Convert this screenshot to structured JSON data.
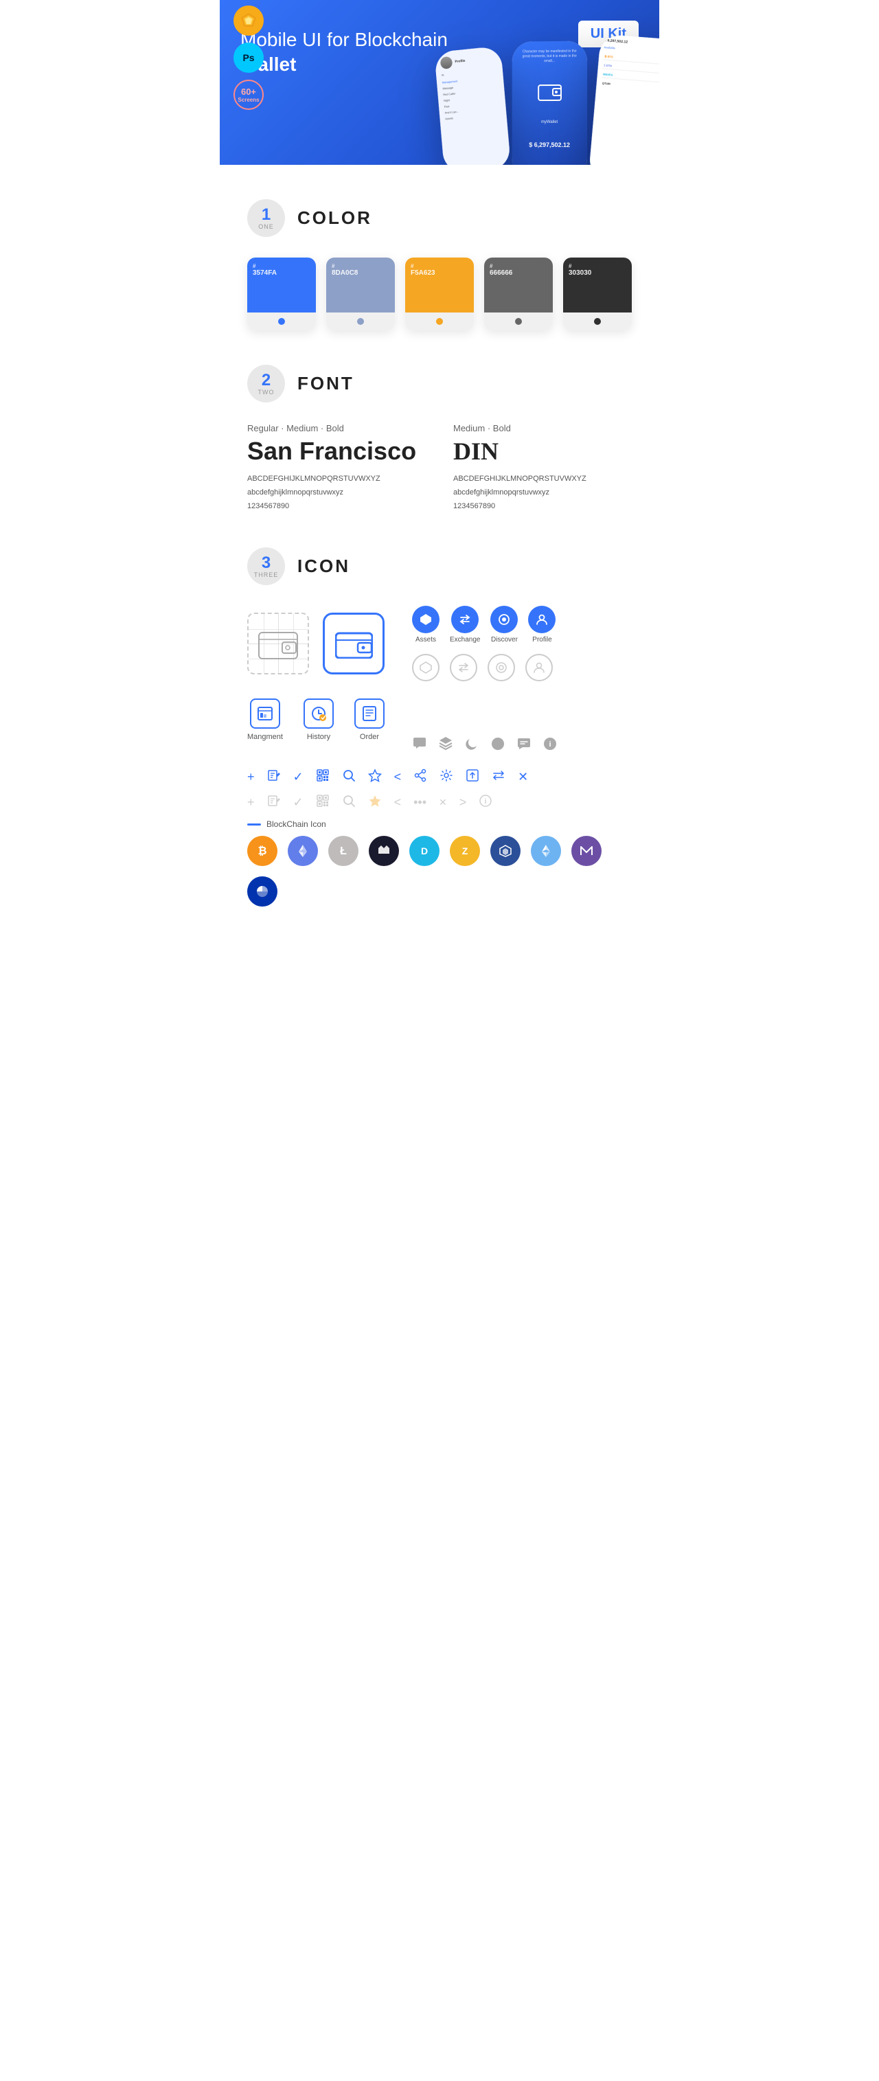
{
  "hero": {
    "title_regular": "Mobile UI for Blockchain ",
    "title_bold": "Wallet",
    "badge": "UI Kit",
    "sketch_label": "Sketch",
    "ps_label": "Ps",
    "screens_count": "60+",
    "screens_label": "Screens"
  },
  "sections": {
    "color": {
      "number": "1",
      "sub": "ONE",
      "title": "COLOR",
      "swatches": [
        {
          "hex": "#3574FA",
          "label": "3574FA",
          "dot_color": "#fff"
        },
        {
          "hex": "#8DA0C8",
          "label": "8DA0C8",
          "dot_color": "#fff"
        },
        {
          "hex": "#F5A623",
          "label": "F5A623",
          "dot_color": "#fff"
        },
        {
          "hex": "#666666",
          "label": "666666",
          "dot_color": "#fff"
        },
        {
          "hex": "#303030",
          "label": "303030",
          "dot_color": "#fff"
        }
      ]
    },
    "font": {
      "number": "2",
      "sub": "TWO",
      "title": "FONT",
      "font1": {
        "meta": "Regular · Medium · Bold",
        "name": "San Francisco",
        "uppercase": "ABCDEFGHIJKLMNOPQRSTUVWXYZ",
        "lowercase": "abcdefghijklmnopqrstuvwxyz",
        "numbers": "1234567890"
      },
      "font2": {
        "meta": "Medium · Bold",
        "name": "DIN",
        "uppercase": "ABCDEFGHIJKLMNOPQRSTUVWXYZ",
        "lowercase": "abcdefghijklmnopqrstuvwxyz",
        "numbers": "1234567890"
      }
    },
    "icon": {
      "number": "3",
      "sub": "THREE",
      "title": "ICON",
      "nav_icons": [
        {
          "label": "Assets",
          "glyph": "◆"
        },
        {
          "label": "Exchange",
          "glyph": "⇌"
        },
        {
          "label": "Discover",
          "glyph": "●"
        },
        {
          "label": "Profile",
          "glyph": "👤"
        }
      ],
      "bottom_icons": [
        {
          "label": "Mangment",
          "glyph": "▤"
        },
        {
          "label": "History",
          "glyph": "🕐"
        },
        {
          "label": "Order",
          "glyph": "📋"
        }
      ],
      "blockchain_label": "BlockChain Icon",
      "crypto_icons": [
        {
          "symbol": "₿",
          "bg": "#F7931A",
          "label": "BTC"
        },
        {
          "symbol": "Ξ",
          "bg": "#627EEA",
          "label": "ETH"
        },
        {
          "symbol": "Ł",
          "bg": "#BFBBBB",
          "label": "LTC"
        },
        {
          "symbol": "◆",
          "bg": "#1A1A2E",
          "label": "WAVES"
        },
        {
          "symbol": "Ð",
          "bg": "#1EB8E6",
          "label": "DASH"
        },
        {
          "symbol": "Z",
          "bg": "#F4B728",
          "label": "ZEC"
        },
        {
          "symbol": "✦",
          "bg": "#6DB3F2",
          "label": "QTUM"
        },
        {
          "symbol": "⬡",
          "bg": "#2B4F98",
          "label": "ETC"
        },
        {
          "symbol": "◈",
          "bg": "#6C4FA5",
          "label": "XMR"
        },
        {
          "symbol": "∞",
          "bg": "#0033AD",
          "label": "GNO"
        }
      ]
    }
  }
}
